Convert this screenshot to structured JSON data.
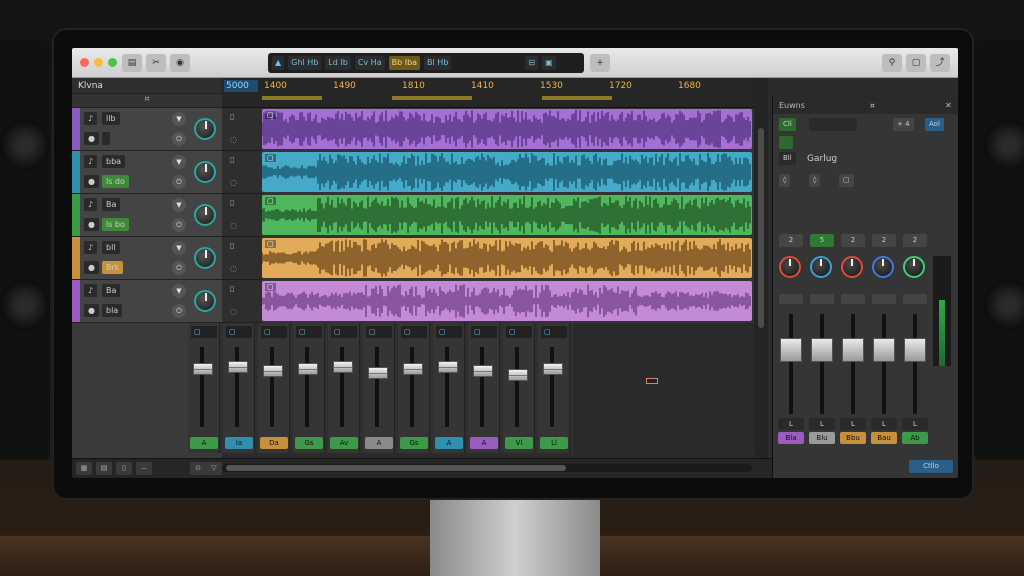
{
  "toolbar": {
    "transport_items": [
      "Ghl Hb",
      "Ld Ib",
      "Cv Ha",
      "Bb Iba",
      "Bl Hb"
    ],
    "right_buttons": [
      "pin-icon",
      "window-icon",
      "share-icon"
    ]
  },
  "tracks_panel": {
    "header": "Klvna",
    "sub": "¤"
  },
  "tracks": [
    {
      "color": "#8a5bc0",
      "chip1": "llb",
      "chip2": "",
      "chip2_color": "#2a2a2a"
    },
    {
      "color": "#2f8fae",
      "chip1": "bba",
      "chip2": "ls do",
      "chip2_color": "#3f8a3a"
    },
    {
      "color": "#3d9a48",
      "chip1": "Ba",
      "chip2": "ls bo",
      "chip2_color": "#3f8a3a"
    },
    {
      "color": "#c7913b",
      "chip1": "bll",
      "chip2": "Brk",
      "chip2_color": "#c7913b"
    },
    {
      "color": "#9a5cc0",
      "chip1": "Ba",
      "chip2": "bla",
      "chip2_color": "#2a2a2a"
    }
  ],
  "ruler": {
    "position": "5000",
    "markers": [
      "1400",
      "1490",
      "1810",
      "1410",
      "1530",
      "1720",
      "1680"
    ]
  },
  "mixer_channels": [
    {
      "label": "A",
      "color": "#3d9a48"
    },
    {
      "label": "la",
      "color": "#2f8fae"
    },
    {
      "label": "Da",
      "color": "#c7913b"
    },
    {
      "label": "Gs",
      "color": "#3d9a48"
    },
    {
      "label": "Av",
      "color": "#3d9a48"
    },
    {
      "label": "A",
      "color": "#8a8a8a"
    },
    {
      "label": "Gs",
      "color": "#3d9a48"
    },
    {
      "label": "A",
      "color": "#2f8fae"
    },
    {
      "label": "A",
      "color": "#9a5cc0"
    },
    {
      "label": "Vl",
      "color": "#3d9a48"
    },
    {
      "label": "Ll",
      "color": "#3d9a48"
    }
  ],
  "inspector": {
    "tabs": [
      "Euwns",
      "¤"
    ],
    "btn_top_left": "Cll",
    "btn_top_mid": "",
    "btn_top_right1": "+ 4",
    "btn_top_right2": "Aol",
    "section_label": "Garlug",
    "section_prefix": "Bll",
    "knob_colors": [
      "#e04a3a",
      "#3aa0d8",
      "#e04a3a",
      "#3a7ae0",
      "#3ad07a"
    ],
    "num_buttons": [
      "2",
      "5",
      "2",
      "2",
      "2"
    ],
    "channels": [
      {
        "label": "Bla",
        "color": "#9a5cc0"
      },
      {
        "label": "Blu",
        "color": "#9a9a9a"
      },
      {
        "label": "Bbu",
        "color": "#c7913b"
      },
      {
        "label": "Bau",
        "color": "#c7913b"
      },
      {
        "label": "Ab",
        "color": "#3d9a48"
      }
    ],
    "bottom_button": "Ctllo"
  }
}
